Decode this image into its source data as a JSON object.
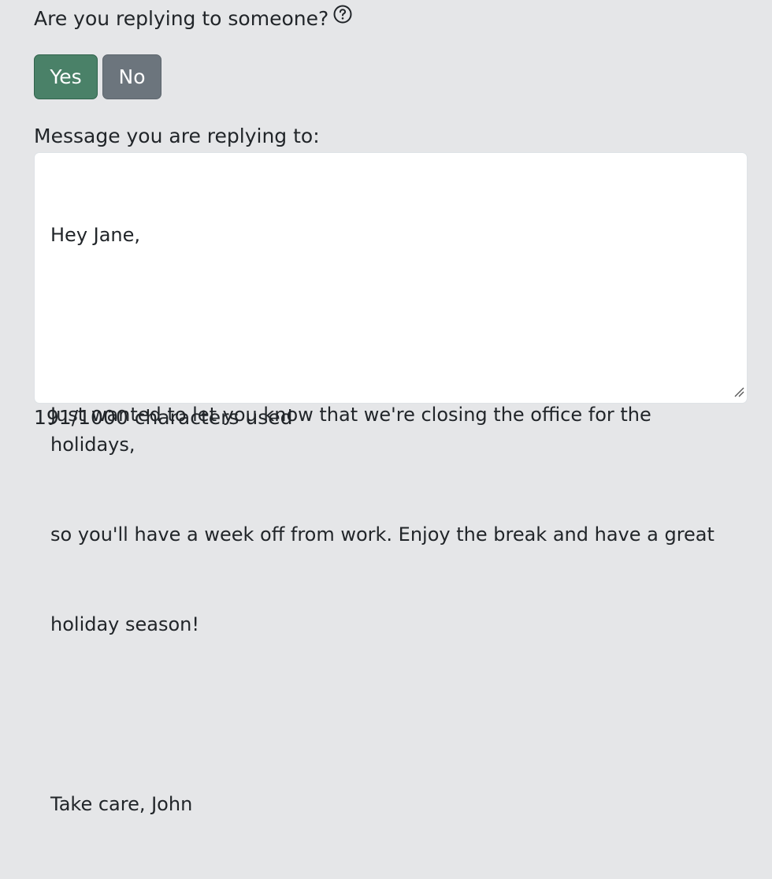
{
  "question": {
    "label": "Are you replying to someone?",
    "help_icon": "question-circle-icon"
  },
  "buttons": {
    "yes_label": "Yes",
    "no_label": "No",
    "yes_color": "#4a8168",
    "no_color": "#6c757d",
    "selected": "Yes"
  },
  "reply": {
    "label": "Message you are replying to:",
    "lines": [
      "Hey Jane,",
      "",
      "Just wanted to let you know that we're closing the office for the holidays,",
      "so you'll have a week off from work. Enjoy the break and have a great",
      "holiday season!",
      "",
      "Take care, John"
    ],
    "resize_icon": "resize-handle-icon"
  },
  "counter": {
    "text": "191/1000 characters used"
  }
}
